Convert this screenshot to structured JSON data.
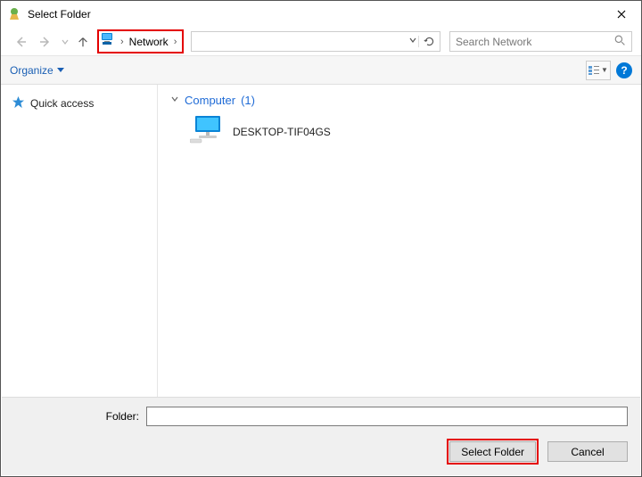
{
  "window": {
    "title": "Select Folder"
  },
  "breadcrumb": {
    "item": "Network"
  },
  "search": {
    "placeholder": "Search Network"
  },
  "toolbar": {
    "organize": "Organize"
  },
  "sidebar": {
    "items": [
      {
        "label": "Quick access"
      }
    ]
  },
  "main": {
    "group_label_prefix": "Computer",
    "group_count": "(1)",
    "devices": [
      {
        "name": "DESKTOP-TIF04GS"
      }
    ]
  },
  "footer": {
    "folder_label": "Folder:",
    "folder_value": "",
    "select_label": "Select Folder",
    "cancel_label": "Cancel"
  }
}
